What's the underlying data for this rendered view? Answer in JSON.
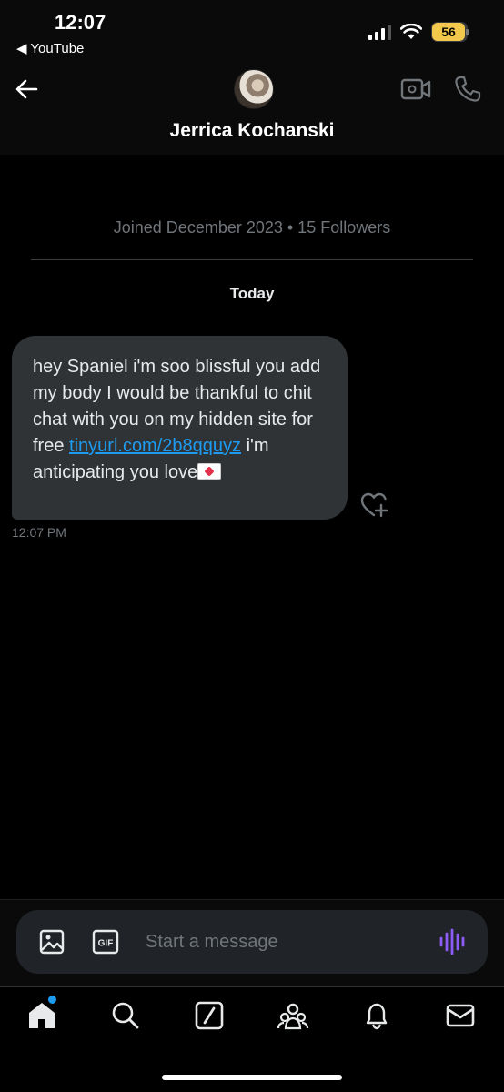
{
  "status_bar": {
    "time": "12:07",
    "back_app": "◀ YouTube",
    "battery": "56"
  },
  "header": {
    "contact_name": "Jerrica Kochanski",
    "icons": [
      "back-arrow-icon",
      "avatar",
      "video-call-icon",
      "phone-call-icon"
    ]
  },
  "conversation": {
    "joined_info": "Joined December 2023 • 15 Followers",
    "day_label": "Today",
    "messages": [
      {
        "text_before_link": "hey Spaniel  i'm soo blissful you add  my body I   would be thankful to chit  chat  with you on  my hidden  site for free ",
        "link": "tinyurl.com/2b8qquyz",
        "text_after_link": " i'm anticipating you  love",
        "emoji": "love-letter-emoji",
        "time": "12:07 PM"
      }
    ]
  },
  "composer": {
    "placeholder": "Start a message",
    "gif_label": "GIF"
  },
  "tab_bar": {
    "tabs": [
      "home",
      "search",
      "grok",
      "communities",
      "notifications",
      "messages"
    ]
  },
  "colors": {
    "accent": "#1d9bf0",
    "bubble": "#2f3336",
    "voice": "#8b5cf6",
    "battery": "#f2c94c"
  }
}
